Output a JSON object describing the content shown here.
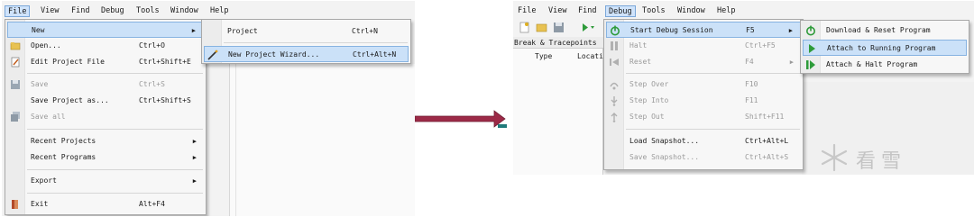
{
  "left": {
    "menubar": [
      {
        "label": "File"
      },
      {
        "label": "View"
      },
      {
        "label": "Find"
      },
      {
        "label": "Debug"
      },
      {
        "label": "Tools"
      },
      {
        "label": "Window"
      },
      {
        "label": "Help"
      }
    ],
    "file_menu": [
      {
        "label": "New",
        "shortcut": "",
        "submenu": true
      },
      {
        "label": "Open...",
        "shortcut": "Ctrl+O"
      },
      {
        "label": "Edit Project File",
        "shortcut": "Ctrl+Shift+E"
      },
      {
        "label": "Save",
        "shortcut": "Ctrl+S",
        "disabled": true
      },
      {
        "label": "Save Project as...",
        "shortcut": "Ctrl+Shift+S"
      },
      {
        "label": "Save all",
        "shortcut": "",
        "disabled": true
      },
      {
        "label": "Recent Projects",
        "shortcut": "",
        "submenu": true
      },
      {
        "label": "Recent Programs",
        "shortcut": "",
        "submenu": true
      },
      {
        "label": "Export",
        "shortcut": "",
        "submenu": true
      },
      {
        "label": "Exit",
        "shortcut": "Alt+F4"
      }
    ],
    "new_submenu": [
      {
        "label": "Project",
        "shortcut": "Ctrl+N"
      },
      {
        "label": "New Project Wizard...",
        "shortcut": "Ctrl+Alt+N"
      }
    ]
  },
  "right": {
    "menubar": [
      {
        "label": "File"
      },
      {
        "label": "View"
      },
      {
        "label": "Find"
      },
      {
        "label": "Debug"
      },
      {
        "label": "Tools"
      },
      {
        "label": "Window"
      },
      {
        "label": "Help"
      }
    ],
    "panel_title": "Break & Tracepoints",
    "panel_columns": [
      "Type",
      "Locati"
    ],
    "debug_menu": [
      {
        "label": "Start Debug Session",
        "shortcut": "F5",
        "submenu": true
      },
      {
        "label": "Halt",
        "shortcut": "Ctrl+F5",
        "disabled": true
      },
      {
        "label": "Reset",
        "shortcut": "F4",
        "disabled": true,
        "submenu": true
      },
      {
        "label": "Step Over",
        "shortcut": "F10",
        "disabled": true
      },
      {
        "label": "Step Into",
        "shortcut": "F11",
        "disabled": true
      },
      {
        "label": "Step Out",
        "shortcut": "Shift+F11",
        "disabled": true
      },
      {
        "label": "Load Snapshot...",
        "shortcut": "Ctrl+Alt+L"
      },
      {
        "label": "Save Snapshot...",
        "shortcut": "Ctrl+Alt+S",
        "disabled": true
      }
    ],
    "start_submenu": [
      {
        "label": "Download & Reset Program"
      },
      {
        "label": "Attach to Running Program"
      },
      {
        "label": "Attach & Halt Program"
      }
    ],
    "watermark": "看雪"
  },
  "colors": {
    "highlight": "#cbe1f8",
    "arrow": "#9c2a47",
    "arrow_tip": "#1f7a7a",
    "green": "#2e9b3a"
  }
}
